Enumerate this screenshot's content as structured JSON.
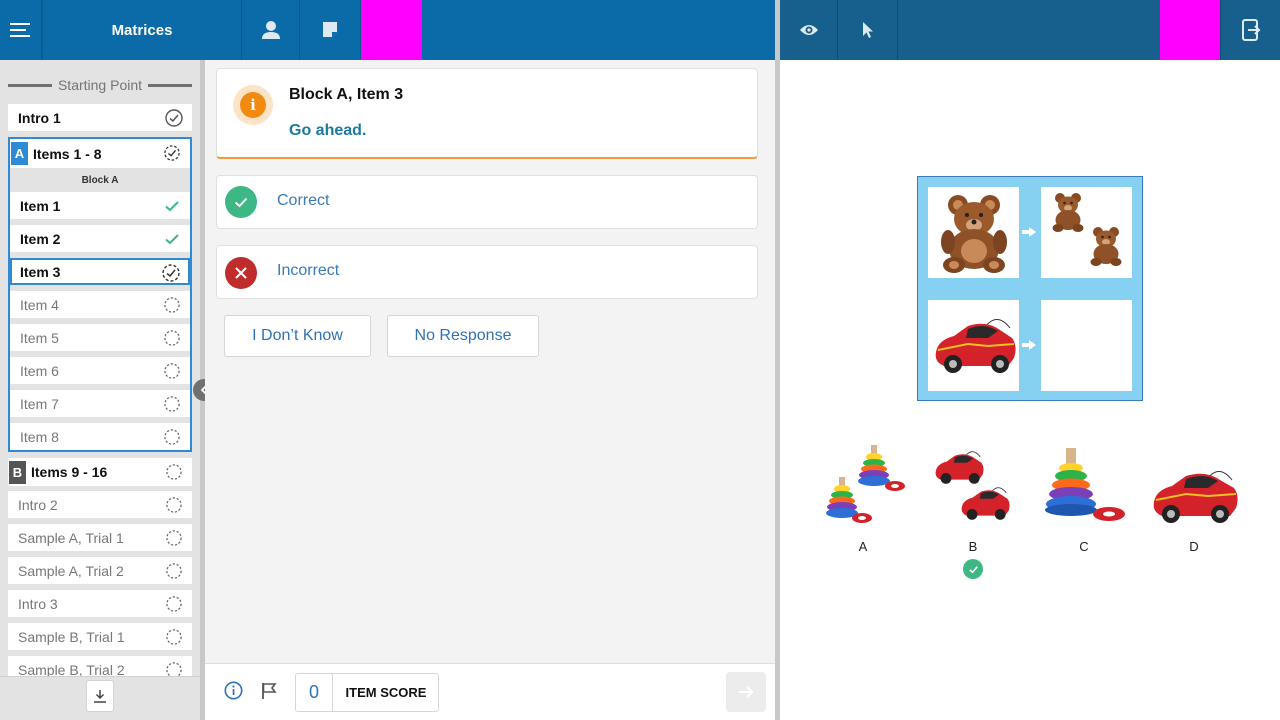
{
  "header": {
    "title": "Matrices",
    "icons": [
      "menu-icon",
      "person-icon",
      "note-icon",
      "eye-icon",
      "cursor-icon",
      "exit-icon"
    ],
    "accent_color": "#0a6ba8",
    "right_color": "#175f8c",
    "marker_color": "#ff00ff"
  },
  "sidebar": {
    "starting_point": "Starting Point",
    "intro1": "Intro 1",
    "block_a": {
      "badge": "A",
      "title": "Items 1 - 8",
      "label": "Block A",
      "items": [
        {
          "label": "Item 1",
          "status": "correct"
        },
        {
          "label": "Item 2",
          "status": "correct"
        },
        {
          "label": "Item 3",
          "status": "current"
        },
        {
          "label": "Item 4",
          "status": "pending"
        },
        {
          "label": "Item 5",
          "status": "pending"
        },
        {
          "label": "Item 6",
          "status": "pending"
        },
        {
          "label": "Item 7",
          "status": "pending"
        },
        {
          "label": "Item 8",
          "status": "pending"
        }
      ]
    },
    "block_b": {
      "badge": "B",
      "title": "Items 9 - 16"
    },
    "rest": [
      {
        "label": "Intro 2"
      },
      {
        "label": "Sample A, Trial 1"
      },
      {
        "label": "Sample A, Trial 2"
      },
      {
        "label": "Intro 3"
      },
      {
        "label": "Sample B, Trial 1"
      },
      {
        "label": "Sample B, Trial 2"
      }
    ]
  },
  "prompt": {
    "title": "Block A, Item 3",
    "message": "Go ahead."
  },
  "responses": {
    "correct": "Correct",
    "incorrect": "Incorrect",
    "dont_know": "I Don’t Know",
    "no_response": "No Response"
  },
  "footer": {
    "score_value": "0",
    "score_label": "ITEM SCORE"
  },
  "stimulus": {
    "choices": [
      "A",
      "B",
      "C",
      "D"
    ],
    "selected": "B"
  }
}
